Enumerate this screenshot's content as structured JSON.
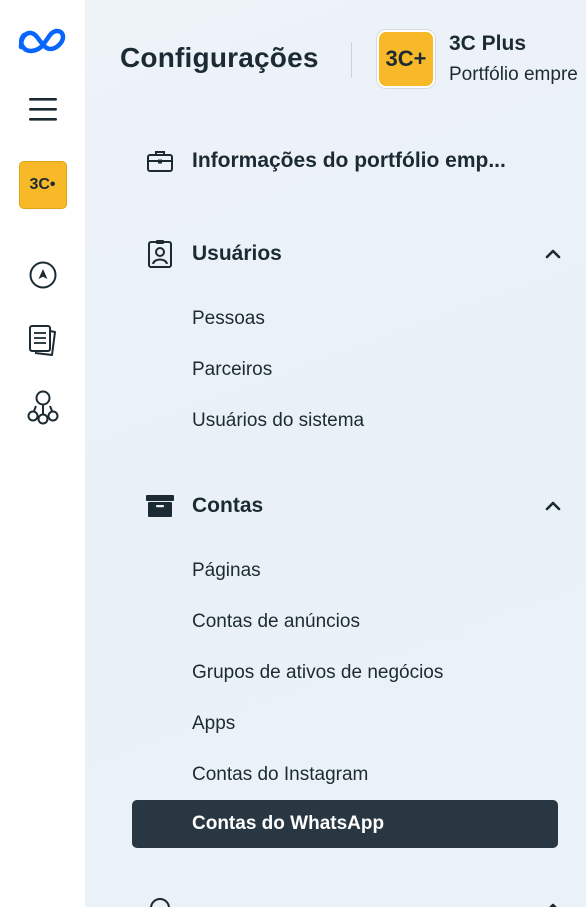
{
  "rail": {
    "logo_icon": "meta-logo-icon",
    "menu_icon": "hamburger-menu-icon",
    "account_logo_text": "3C•",
    "account_logo_color": "#f7b928",
    "nav_icons": [
      "navigate-icon",
      "pages-icon",
      "business-network-icon"
    ]
  },
  "header": {
    "title": "Configurações",
    "business_logo_text": "3C+",
    "business_name": "3C Plus",
    "business_subtitle": "Portfólio empre"
  },
  "sections": {
    "info": {
      "label": "Informações do portfólio emp...",
      "icon": "briefcase-icon"
    },
    "users": {
      "label": "Usuários",
      "icon": "id-badge-icon",
      "expanded": true,
      "items": [
        "Pessoas",
        "Parceiros",
        "Usuários do sistema"
      ]
    },
    "accounts": {
      "label": "Contas",
      "icon": "archive-box-icon",
      "expanded": true,
      "items": [
        "Páginas",
        "Contas de anúncios",
        "Grupos de ativos de negócios",
        "Apps",
        "Contas do Instagram"
      ],
      "active_item": "Contas do WhatsApp"
    }
  },
  "colors": {
    "accent_yellow": "#f7b928",
    "meta_blue": "#0866ff",
    "active_bg": "#293742",
    "text": "#1c2b33"
  }
}
